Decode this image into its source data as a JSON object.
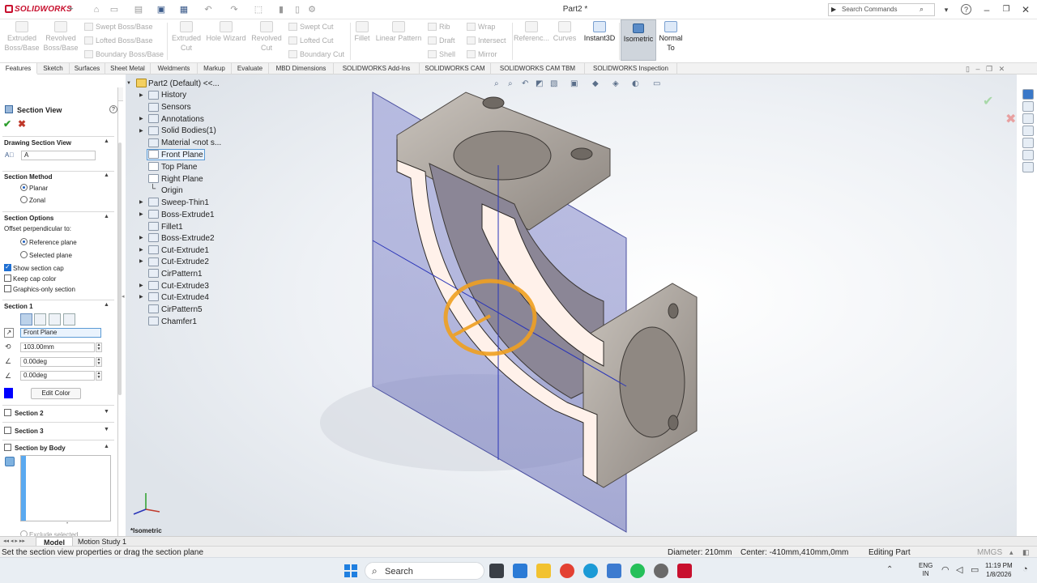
{
  "app": {
    "name": "SOLIDWORKS",
    "document_title": "Part2 *"
  },
  "search": {
    "placeholder": "Search Commands"
  },
  "ribbon": {
    "extruded_boss": "Extruded Boss/Base",
    "revolved_boss": "Revolved Boss/Base",
    "swept_boss": "Swept Boss/Base",
    "lofted_boss": "Lofted Boss/Base",
    "boundary_boss": "Boundary Boss/Base",
    "extruded_cut": "Extruded Cut",
    "hole_wizard": "Hole Wizard",
    "revolved_cut": "Revolved Cut",
    "swept_cut": "Swept Cut",
    "lofted_cut": "Lofted Cut",
    "boundary_cut": "Boundary Cut",
    "fillet": "Fillet",
    "linear_pattern": "Linear Pattern",
    "rib": "Rib",
    "draft": "Draft",
    "shell": "Shell",
    "wrap": "Wrap",
    "intersect": "Intersect",
    "mirror": "Mirror",
    "reference": "Referenc...",
    "curves": "Curves",
    "instant3d": "Instant3D",
    "isometric": "Isometric",
    "normal_to": "Normal To"
  },
  "tabs": [
    "Features",
    "Sketch",
    "Surfaces",
    "Sheet Metal",
    "Weldments",
    "Markup",
    "Evaluate",
    "MBD Dimensions",
    "SOLIDWORKS Add-Ins",
    "SOLIDWORKS CAM",
    "SOLIDWORKS CAM TBM",
    "SOLIDWORKS Inspection"
  ],
  "property_manager": {
    "title": "Section View",
    "drawing_section_view": {
      "heading": "Drawing Section View",
      "name_value": "A"
    },
    "section_method": {
      "heading": "Section Method",
      "options": [
        "Planar",
        "Zonal"
      ],
      "selected": "Planar"
    },
    "section_options": {
      "heading": "Section Options",
      "offset_label": "Offset perpendicular to:",
      "reference_plane": "Reference plane",
      "selected_plane": "Selected plane",
      "show_section_cap": "Show section cap",
      "keep_cap_color": "Keep cap color",
      "graphics_only": "Graphics-only section"
    },
    "section1": {
      "heading": "Section 1",
      "plane": "Front Plane",
      "offset": "103.00mm",
      "angle_x": "0.00deg",
      "angle_y": "0.00deg",
      "edit_color": "Edit Color",
      "cap_color": "#0000ff"
    },
    "section2": "Section 2",
    "section3": "Section 3",
    "section_by_body": "Section by Body",
    "exclude_selected": "Exclude selected"
  },
  "feature_tree": {
    "root": "Part2 (Default) <<...",
    "items": [
      "History",
      "Sensors",
      "Annotations",
      "Solid Bodies(1)",
      "Material <not s...",
      "Front Plane",
      "Top Plane",
      "Right Plane",
      "Origin",
      "Sweep-Thin1",
      "Boss-Extrude1",
      "Fillet1",
      "Boss-Extrude2",
      "Cut-Extrude1",
      "Cut-Extrude2",
      "CirPattern1",
      "Cut-Extrude3",
      "Cut-Extrude4",
      "CirPattern5",
      "Chamfer1"
    ]
  },
  "viewport": {
    "view_name": "*Isometric"
  },
  "model_tabs": [
    "Model",
    "Motion Study 1"
  ],
  "status": {
    "message": "Set the section view properties or drag the section plane",
    "diameter": "Diameter: 210mm",
    "center": "Center: -410mm,410mm,0mm",
    "mode": "Editing Part",
    "units": "MMGS"
  },
  "taskbar": {
    "search": "Search",
    "lang": "ENG",
    "region": "IN",
    "time": "11:19 PM",
    "date": "1/8/2026"
  },
  "colors": {
    "accent": "#1f6fd2",
    "section_plane": "#7a7fc4",
    "section_cap": "#fff1ea",
    "part_metal": "#a49e98"
  }
}
